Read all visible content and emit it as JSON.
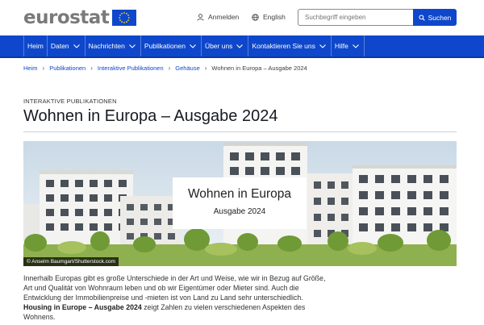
{
  "header": {
    "logo": "eurostat",
    "login_label": "Anmelden",
    "language_label": "English",
    "search": {
      "placeholder": "Suchbegriff eingeben",
      "button_label": "Suchen"
    }
  },
  "nav": {
    "items": [
      {
        "label": "Heim",
        "has_dropdown": false
      },
      {
        "label": "Daten",
        "has_dropdown": true
      },
      {
        "label": "Nachrichten",
        "has_dropdown": true
      },
      {
        "label": "Publikationen",
        "has_dropdown": true
      },
      {
        "label": "Über uns",
        "has_dropdown": true
      },
      {
        "label": "Kontaktieren Sie uns",
        "has_dropdown": true
      },
      {
        "label": "Hilfe",
        "has_dropdown": true
      }
    ]
  },
  "breadcrumb": {
    "links": [
      "Heim",
      "Publikationen",
      "Interaktive Publikationen",
      "Gehäuse"
    ],
    "current": "Wohnen in Europa – Ausgabe 2024"
  },
  "page": {
    "eyebrow": "INTERAKTIVE PUBLIKATIONEN",
    "title": "Wohnen in Europa – Ausgabe 2024",
    "hero_title": "Wohnen in Europa",
    "hero_subtitle": "Ausgabe 2024",
    "credit": "© Anselm Baumgart/Shutterstock.com",
    "intro_part1": "Innerhalb Europas gibt es große Unterschiede in der Art und Weise, wie wir in Bezug auf Größe, Art und Qualität von Wohnraum leben und ob wir Eigentümer oder Mieter sind. Auch die Entwicklung der Immobilienpreise und -mieten ist von Land zu Land sehr unterschiedlich.",
    "intro_bold": "Housing in Europe – Ausgabe 2024",
    "intro_part2": "zeigt Zahlen zu vielen verschiedenen Aspekten des Wohnens."
  },
  "colors": {
    "brand_blue": "#0e47cb",
    "logo_grey": "#7a7a7a",
    "eu_yellow": "#ffd617"
  }
}
